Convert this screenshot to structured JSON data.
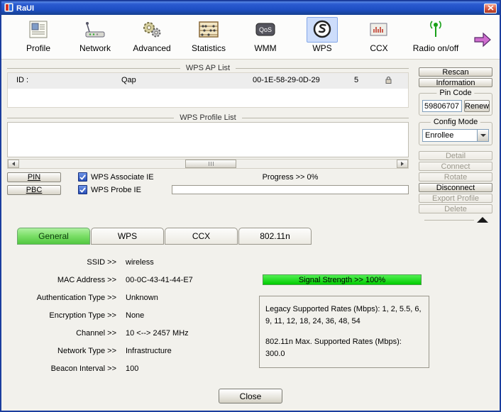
{
  "window": {
    "title": "RaUI"
  },
  "toolbar": {
    "items": [
      {
        "label": "Profile"
      },
      {
        "label": "Network"
      },
      {
        "label": "Advanced"
      },
      {
        "label": "Statistics"
      },
      {
        "label": "WMM"
      },
      {
        "label": "WPS"
      },
      {
        "label": "CCX"
      },
      {
        "label": "Radio on/off"
      }
    ]
  },
  "icons": {
    "qos_text": "QoS"
  },
  "ap_list": {
    "title": "WPS AP List",
    "row": {
      "id_label": "ID :",
      "ssid": "Qap",
      "mac": "00-1E-58-29-0D-29",
      "channel": "5"
    }
  },
  "profile_list": {
    "title": "WPS Profile List"
  },
  "wps_controls": {
    "pin": "PIN",
    "pbc": "PBC",
    "associate_ie": "WPS Associate IE",
    "probe_ie": "WPS Probe IE",
    "progress": "Progress >> 0%"
  },
  "side": {
    "rescan": "Rescan",
    "information": "Information",
    "pin_code_label": "Pin Code",
    "pin_code_value": "59806707",
    "renew": "Renew",
    "config_mode_label": "Config Mode",
    "config_mode_value": "Enrollee",
    "detail": "Detail",
    "connect": "Connect",
    "rotate": "Rotate",
    "disconnect": "Disconnect",
    "export_profile": "Export Profile",
    "delete": "Delete"
  },
  "tabs": [
    {
      "label": "General"
    },
    {
      "label": "WPS"
    },
    {
      "label": "CCX"
    },
    {
      "label": "802.11n"
    }
  ],
  "general": {
    "fields": [
      {
        "label": "SSID >>",
        "value": "wireless"
      },
      {
        "label": "MAC Address >>",
        "value": "00-0C-43-41-44-E7"
      },
      {
        "label": "Authentication Type >>",
        "value": "Unknown"
      },
      {
        "label": "Encryption Type >>",
        "value": "None"
      },
      {
        "label": "Channel >>",
        "value": "10 <--> 2457 MHz"
      },
      {
        "label": "Network Type >>",
        "value": "Infrastructure"
      },
      {
        "label": "Beacon Interval >>",
        "value": "100"
      }
    ],
    "signal_strength": "Signal Strength >> 100%",
    "rates_legacy": "Legacy Supported Rates (Mbps): 1, 2, 5.5, 6, 9, 11, 12, 18, 24, 36, 48, 54",
    "rates_ht": "802.11n Max. Supported Rates (Mbps): 300.0"
  },
  "footer": {
    "close": "Close"
  },
  "colors": {
    "titlebar_blue": "#1e4fc4",
    "tab_active_green": "#7ade66",
    "signal_green": "#00cc00",
    "selected_icon_bg": "#cdddfb",
    "checkbox_blue": "#2a50b8"
  }
}
